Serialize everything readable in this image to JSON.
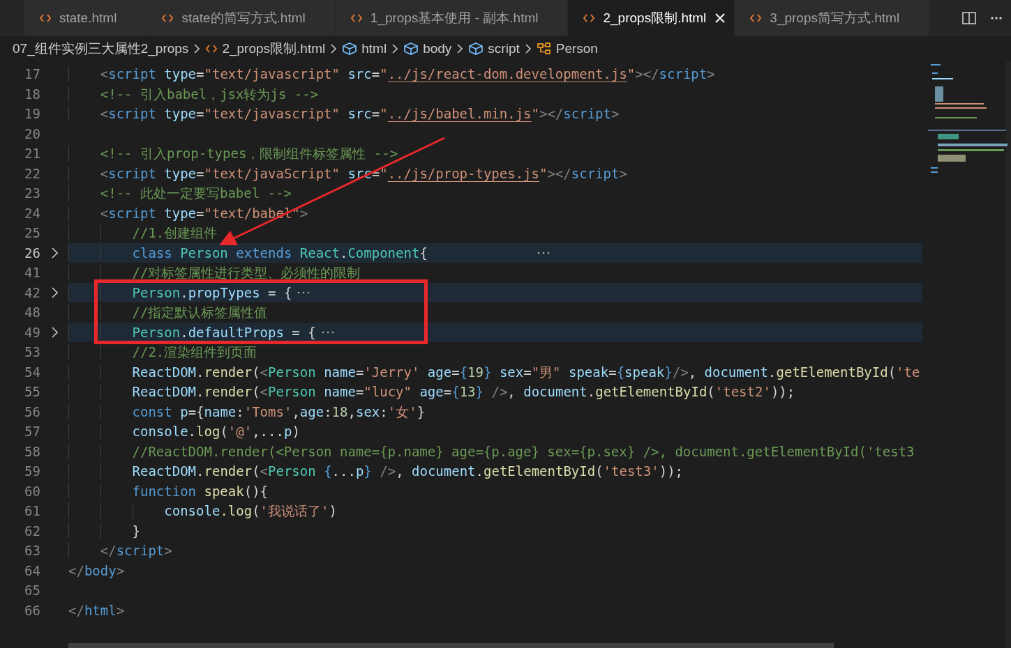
{
  "tabs": [
    {
      "label": "state.html",
      "selected": false
    },
    {
      "label": "state的简写方式.html",
      "selected": false
    },
    {
      "label": "1_props基本使用 - 副本.html",
      "selected": false
    },
    {
      "label": "2_props限制.html",
      "selected": true
    },
    {
      "label": "3_props简写方式.html",
      "selected": false
    }
  ],
  "breadcrumb": [
    {
      "kind": "folder",
      "label": "07_组件实例三大属性2_props"
    },
    {
      "kind": "file",
      "label": "2_props限制.html"
    },
    {
      "kind": "element",
      "label": "html"
    },
    {
      "kind": "element",
      "label": "body"
    },
    {
      "kind": "element",
      "label": "script"
    },
    {
      "kind": "class",
      "label": "Person"
    }
  ],
  "lines": [
    {
      "number": "17",
      "folded": false,
      "current": false,
      "tokens": [
        {
          "kind": "p",
          "text": "    <"
        },
        {
          "kind": "tag",
          "text": "script"
        },
        {
          "kind": "attr",
          "text": " type"
        },
        {
          "kind": "txt",
          "text": "="
        },
        {
          "kind": "str",
          "text": "\"text/javascript\""
        },
        {
          "kind": "attr",
          "text": " src"
        },
        {
          "kind": "txt",
          "text": "="
        },
        {
          "kind": "str",
          "text": "\""
        },
        {
          "kind": "link",
          "text": "../js/react-dom.development.js"
        },
        {
          "kind": "str",
          "text": "\""
        },
        {
          "kind": "p",
          "text": "></"
        },
        {
          "kind": "tag",
          "text": "script"
        },
        {
          "kind": "p",
          "text": ">"
        }
      ]
    },
    {
      "number": "18",
      "folded": false,
      "current": false,
      "tokens": [
        {
          "kind": "cmt",
          "text": "    <!-- 引入babel，jsx转为js -->"
        }
      ]
    },
    {
      "number": "19",
      "folded": false,
      "current": false,
      "tokens": [
        {
          "kind": "p",
          "text": "    <"
        },
        {
          "kind": "tag",
          "text": "script"
        },
        {
          "kind": "attr",
          "text": " type"
        },
        {
          "kind": "txt",
          "text": "="
        },
        {
          "kind": "str",
          "text": "\"text/javascript\""
        },
        {
          "kind": "attr",
          "text": " src"
        },
        {
          "kind": "txt",
          "text": "="
        },
        {
          "kind": "str",
          "text": "\""
        },
        {
          "kind": "link",
          "text": "../js/babel.min.js"
        },
        {
          "kind": "str",
          "text": "\""
        },
        {
          "kind": "p",
          "text": "></"
        },
        {
          "kind": "tag",
          "text": "script"
        },
        {
          "kind": "p",
          "text": ">"
        }
      ]
    },
    {
      "number": "20",
      "folded": false,
      "current": false
    },
    {
      "number": "21",
      "folded": false,
      "current": false,
      "tokens": [
        {
          "kind": "cmt",
          "text": "    <!-- 引入prop-types，限制组件标签属性 -->"
        }
      ]
    },
    {
      "number": "22",
      "folded": false,
      "current": false,
      "tokens": [
        {
          "kind": "p",
          "text": "    <"
        },
        {
          "kind": "tag",
          "text": "script"
        },
        {
          "kind": "attr",
          "text": " type"
        },
        {
          "kind": "txt",
          "text": "="
        },
        {
          "kind": "str",
          "text": "\"text/javaScript\""
        },
        {
          "kind": "attr",
          "text": " src"
        },
        {
          "kind": "txt",
          "text": "="
        },
        {
          "kind": "str",
          "text": "\""
        },
        {
          "kind": "link",
          "text": "../js/prop-types.js"
        },
        {
          "kind": "str",
          "text": "\""
        },
        {
          "kind": "p",
          "text": "></"
        },
        {
          "kind": "tag",
          "text": "script"
        },
        {
          "kind": "p",
          "text": ">"
        }
      ]
    },
    {
      "number": "23",
      "folded": false,
      "current": false,
      "tokens": [
        {
          "kind": "cmt",
          "text": "    <!-- 此处一定要写babel -->"
        }
      ]
    },
    {
      "number": "24",
      "folded": false,
      "current": false,
      "tokens": [
        {
          "kind": "p",
          "text": "    <"
        },
        {
          "kind": "tag",
          "text": "script"
        },
        {
          "kind": "attr",
          "text": " type"
        },
        {
          "kind": "txt",
          "text": "="
        },
        {
          "kind": "str",
          "text": "\"text/babel\""
        },
        {
          "kind": "p",
          "text": ">"
        }
      ]
    },
    {
      "number": "25",
      "folded": false,
      "current": false,
      "tokens": [
        {
          "kind": "cmt",
          "text": "        //1.创建组件"
        }
      ]
    },
    {
      "number": "26",
      "folded": true,
      "current": true,
      "tokens": [
        {
          "kind": "kw",
          "text": "        class"
        },
        {
          "kind": "cls",
          "text": " Person"
        },
        {
          "kind": "kw",
          "text": " extends"
        },
        {
          "kind": "cls",
          "text": " React"
        },
        {
          "kind": "txt",
          "text": "."
        },
        {
          "kind": "cls",
          "text": "Component"
        },
        {
          "kind": "txt",
          "text": "{             "
        }
      ]
    },
    {
      "number": "41",
      "folded": false,
      "current": false,
      "tokens": [
        {
          "kind": "cmt",
          "text": "        //对标签属性进行类型、必须性的限制"
        }
      ]
    },
    {
      "number": "42",
      "folded": true,
      "current": false,
      "tokens": [
        {
          "kind": "cls",
          "text": "        Person"
        },
        {
          "kind": "txt",
          "text": "."
        },
        {
          "kind": "var",
          "text": "propTypes"
        },
        {
          "kind": "txt",
          "text": " = {"
        }
      ]
    },
    {
      "number": "48",
      "folded": false,
      "current": false,
      "tokens": [
        {
          "kind": "cmt",
          "text": "        //指定默认标签属性值"
        }
      ]
    },
    {
      "number": "49",
      "folded": true,
      "current": false,
      "tokens": [
        {
          "kind": "cls",
          "text": "        Person"
        },
        {
          "kind": "txt",
          "text": "."
        },
        {
          "kind": "var",
          "text": "defaultProps"
        },
        {
          "kind": "txt",
          "text": " = {"
        }
      ]
    },
    {
      "number": "53",
      "folded": false,
      "current": false,
      "tokens": [
        {
          "kind": "cmt",
          "text": "        //2.渲染组件到页面"
        }
      ]
    },
    {
      "number": "54",
      "folded": false,
      "current": false,
      "tokens": [
        {
          "kind": "var",
          "text": "        ReactDOM"
        },
        {
          "kind": "txt",
          "text": "."
        },
        {
          "kind": "fn",
          "text": "render"
        },
        {
          "kind": "txt",
          "text": "("
        },
        {
          "kind": "p",
          "text": "<"
        },
        {
          "kind": "cls",
          "text": "Person"
        },
        {
          "kind": "attr",
          "text": " name"
        },
        {
          "kind": "txt",
          "text": "="
        },
        {
          "kind": "str",
          "text": "'Jerry'"
        },
        {
          "kind": "attr",
          "text": " age"
        },
        {
          "kind": "txt",
          "text": "="
        },
        {
          "kind": "kw",
          "text": "{"
        },
        {
          "kind": "num",
          "text": "19"
        },
        {
          "kind": "kw",
          "text": "}"
        },
        {
          "kind": "attr",
          "text": " sex"
        },
        {
          "kind": "txt",
          "text": "="
        },
        {
          "kind": "str",
          "text": "\"男\""
        },
        {
          "kind": "attr",
          "text": " speak"
        },
        {
          "kind": "txt",
          "text": "="
        },
        {
          "kind": "kw",
          "text": "{"
        },
        {
          "kind": "var",
          "text": "speak"
        },
        {
          "kind": "kw",
          "text": "}"
        },
        {
          "kind": "p",
          "text": "/>"
        },
        {
          "kind": "txt",
          "text": ","
        },
        {
          "kind": "var",
          "text": " document"
        },
        {
          "kind": "txt",
          "text": "."
        },
        {
          "kind": "fn",
          "text": "getElementById"
        },
        {
          "kind": "txt",
          "text": "("
        },
        {
          "kind": "str",
          "text": "'te"
        }
      ]
    },
    {
      "number": "55",
      "folded": false,
      "current": false,
      "tokens": [
        {
          "kind": "var",
          "text": "        ReactDOM"
        },
        {
          "kind": "txt",
          "text": "."
        },
        {
          "kind": "fn",
          "text": "render"
        },
        {
          "kind": "txt",
          "text": "("
        },
        {
          "kind": "p",
          "text": "<"
        },
        {
          "kind": "cls",
          "text": "Person"
        },
        {
          "kind": "attr",
          "text": " name"
        },
        {
          "kind": "txt",
          "text": "="
        },
        {
          "kind": "str",
          "text": "\"lucy\""
        },
        {
          "kind": "attr",
          "text": " age"
        },
        {
          "kind": "txt",
          "text": "="
        },
        {
          "kind": "kw",
          "text": "{"
        },
        {
          "kind": "num",
          "text": "13"
        },
        {
          "kind": "kw",
          "text": "}"
        },
        {
          "kind": "p",
          "text": " />"
        },
        {
          "kind": "txt",
          "text": ","
        },
        {
          "kind": "var",
          "text": " document"
        },
        {
          "kind": "txt",
          "text": "."
        },
        {
          "kind": "fn",
          "text": "getElementById"
        },
        {
          "kind": "txt",
          "text": "("
        },
        {
          "kind": "str",
          "text": "'test2'"
        },
        {
          "kind": "txt",
          "text": "));"
        }
      ]
    },
    {
      "number": "56",
      "folded": false,
      "current": false,
      "tokens": [
        {
          "kind": "kw",
          "text": "        const"
        },
        {
          "kind": "var",
          "text": " p"
        },
        {
          "kind": "txt",
          "text": "={"
        },
        {
          "kind": "var",
          "text": "name"
        },
        {
          "kind": "txt",
          "text": ":"
        },
        {
          "kind": "str",
          "text": "'Toms'"
        },
        {
          "kind": "txt",
          "text": ","
        },
        {
          "kind": "var",
          "text": "age"
        },
        {
          "kind": "txt",
          "text": ":"
        },
        {
          "kind": "num",
          "text": "18"
        },
        {
          "kind": "txt",
          "text": ","
        },
        {
          "kind": "var",
          "text": "sex"
        },
        {
          "kind": "txt",
          "text": ":"
        },
        {
          "kind": "str",
          "text": "'女'"
        },
        {
          "kind": "txt",
          "text": "}"
        }
      ]
    },
    {
      "number": "57",
      "folded": false,
      "current": false,
      "tokens": [
        {
          "kind": "var",
          "text": "        console"
        },
        {
          "kind": "txt",
          "text": "."
        },
        {
          "kind": "fn",
          "text": "log"
        },
        {
          "kind": "txt",
          "text": "("
        },
        {
          "kind": "str",
          "text": "'@'"
        },
        {
          "kind": "txt",
          "text": ",..."
        },
        {
          "kind": "var",
          "text": "p"
        },
        {
          "kind": "txt",
          "text": ")"
        }
      ]
    },
    {
      "number": "58",
      "folded": false,
      "current": false,
      "tokens": [
        {
          "kind": "cmt",
          "text": "        //ReactDOM.render(<Person name={p.name} age={p.age} sex={p.sex} />, document.getElementById('test3"
        }
      ]
    },
    {
      "number": "59",
      "folded": false,
      "current": false,
      "tokens": [
        {
          "kind": "var",
          "text": "        ReactDOM"
        },
        {
          "kind": "txt",
          "text": "."
        },
        {
          "kind": "fn",
          "text": "render"
        },
        {
          "kind": "txt",
          "text": "("
        },
        {
          "kind": "p",
          "text": "<"
        },
        {
          "kind": "cls",
          "text": "Person"
        },
        {
          "kind": "kw",
          "text": " {"
        },
        {
          "kind": "txt",
          "text": "..."
        },
        {
          "kind": "var",
          "text": "p"
        },
        {
          "kind": "kw",
          "text": "}"
        },
        {
          "kind": "p",
          "text": " />"
        },
        {
          "kind": "txt",
          "text": ","
        },
        {
          "kind": "var",
          "text": " document"
        },
        {
          "kind": "txt",
          "text": "."
        },
        {
          "kind": "fn",
          "text": "getElementById"
        },
        {
          "kind": "txt",
          "text": "("
        },
        {
          "kind": "str",
          "text": "'test3'"
        },
        {
          "kind": "txt",
          "text": "));"
        }
      ]
    },
    {
      "number": "60",
      "folded": false,
      "current": false,
      "tokens": [
        {
          "kind": "kw",
          "text": "        function"
        },
        {
          "kind": "fn",
          "text": " speak"
        },
        {
          "kind": "txt",
          "text": "(){"
        }
      ]
    },
    {
      "number": "61",
      "folded": false,
      "current": false,
      "tokens": [
        {
          "kind": "var",
          "text": "            console"
        },
        {
          "kind": "fn",
          "text": ".log"
        },
        {
          "kind": "txt",
          "text": "("
        },
        {
          "kind": "str",
          "text": "'我说话了'"
        },
        {
          "kind": "txt",
          "text": ")"
        }
      ]
    },
    {
      "number": "62",
      "folded": false,
      "current": false,
      "tokens": [
        {
          "kind": "txt",
          "text": "        }"
        }
      ]
    },
    {
      "number": "63",
      "folded": false,
      "current": false,
      "tokens": [
        {
          "kind": "p",
          "text": "    </"
        },
        {
          "kind": "tag",
          "text": "script"
        },
        {
          "kind": "p",
          "text": ">"
        }
      ]
    },
    {
      "number": "64",
      "folded": false,
      "current": false,
      "tokens": [
        {
          "kind": "p",
          "text": "</"
        },
        {
          "kind": "tag",
          "text": "body"
        },
        {
          "kind": "p",
          "text": ">"
        }
      ]
    },
    {
      "number": "65",
      "folded": false,
      "current": false
    },
    {
      "number": "66",
      "folded": false,
      "current": false,
      "tokens": [
        {
          "kind": "p",
          "text": "</"
        },
        {
          "kind": "tag",
          "text": "html"
        },
        {
          "kind": "p",
          "text": ">"
        }
      ]
    }
  ]
}
